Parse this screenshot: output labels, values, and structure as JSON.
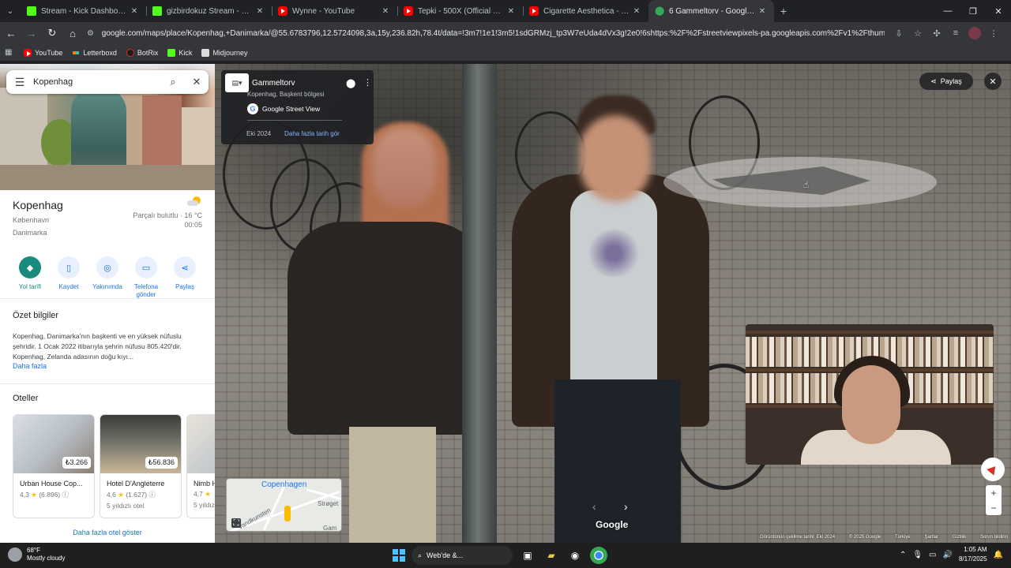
{
  "browser": {
    "tabs": [
      {
        "title": "Stream - Kick Dashboard",
        "favicon": "kick"
      },
      {
        "title": "gizbirdokuz Stream - Watch Live",
        "favicon": "kick"
      },
      {
        "title": "Wynne - YouTube",
        "favicon": "youtube"
      },
      {
        "title": "Tepki - 500X (Official Music Video)",
        "favicon": "youtube"
      },
      {
        "title": "Cigarette Aesthetica - YouTube",
        "favicon": "youtube"
      },
      {
        "title": "6 Gammeltorv - Google Haritalar",
        "favicon": "maps",
        "active": true
      }
    ],
    "url": "google.com/maps/place/Kopenhag,+Danimarka/@55.6783796,12.5724098,3a,15y,236.82h,78.4t/data=!3m7!1e1!3m5!1sdGRMzj_tp3W7eUda4dVx3g!2e0!6shttps:%2F%2Fstreetviewpixels-pa.googleapis.com%2Fv1%2Fthumbnail%3Fcb_client",
    "bookmarks": [
      {
        "label": "YouTube",
        "favicon": "youtube"
      },
      {
        "label": "Letterboxd",
        "favicon": "letterboxd"
      },
      {
        "label": "BotRix",
        "favicon": "botrix"
      },
      {
        "label": "Kick",
        "favicon": "kick"
      },
      {
        "label": "Midjourney",
        "favicon": "midjourney"
      }
    ]
  },
  "sidebar": {
    "search_query": "Kopenhag",
    "place": {
      "title": "Kopenhag",
      "sub1": "København",
      "sub2": "Danimarka"
    },
    "weather": {
      "condition": "Parçalı bulutlu · 16 °C",
      "time": "00:05"
    },
    "actions": [
      {
        "label": "Yol tarifi",
        "icon": "directions-icon"
      },
      {
        "label": "Kaydet",
        "icon": "bookmark-icon"
      },
      {
        "label": "Yakınımda",
        "icon": "nearby-icon"
      },
      {
        "label": "Telefona gönder",
        "icon": "send-to-phone-icon"
      },
      {
        "label": "Paylaş",
        "icon": "share-icon"
      }
    ],
    "summary": {
      "heading": "Özet bilgiler",
      "text": "Kopenhag, Danimarka'nın başkenti ve en yüksek nüfuslu şehridir. 1 Ocak 2022 itibarıyla şehrin nüfusu 805.420'dir. Kopenhag, Zelanda adasının doğu kıyı...",
      "more": "Daha fazla"
    },
    "hotels": {
      "heading": "Oteller",
      "items": [
        {
          "name": "Urban House Cop...",
          "price": "₺3.266",
          "rating": "4,3",
          "reviews": "(6.896)",
          "class": ""
        },
        {
          "name": "Hotel D'Angleterre",
          "price": "₺56.836",
          "rating": "4,6",
          "reviews": "(1.627)",
          "class": "5 yıldızlı otel"
        },
        {
          "name": "Nimb H...",
          "price": "",
          "rating": "4,7",
          "reviews": "",
          "class": "5 yıldız"
        }
      ],
      "show_more": "Daha fazla otel göster"
    }
  },
  "streetview": {
    "place_name": "Gammeltorv",
    "place_location": "Kopenhag, Başkent bölgesi",
    "provider": "Google Street View",
    "date": "Eki 2024",
    "history_link": "Daha fazla tarih gör",
    "share_label": "Paylaş",
    "minimap_city": "Copenhagen",
    "minimap_street": "Strøget",
    "minimap_street2": "Gam",
    "minimap_street3": "Vandkunsten",
    "google_logo": "Google",
    "footer": [
      "Görüntünün çekilme tarihi: Eki 2024",
      "© 2025 Google",
      "Türkiye",
      "Şartlar",
      "Gizlilik",
      "Sorun bildirin"
    ]
  },
  "taskbar": {
    "temp": "68°F",
    "condition": "Mostly cloudy",
    "search_label": "Web'de &...",
    "time": "1:05 AM",
    "date": "8/17/2025"
  }
}
